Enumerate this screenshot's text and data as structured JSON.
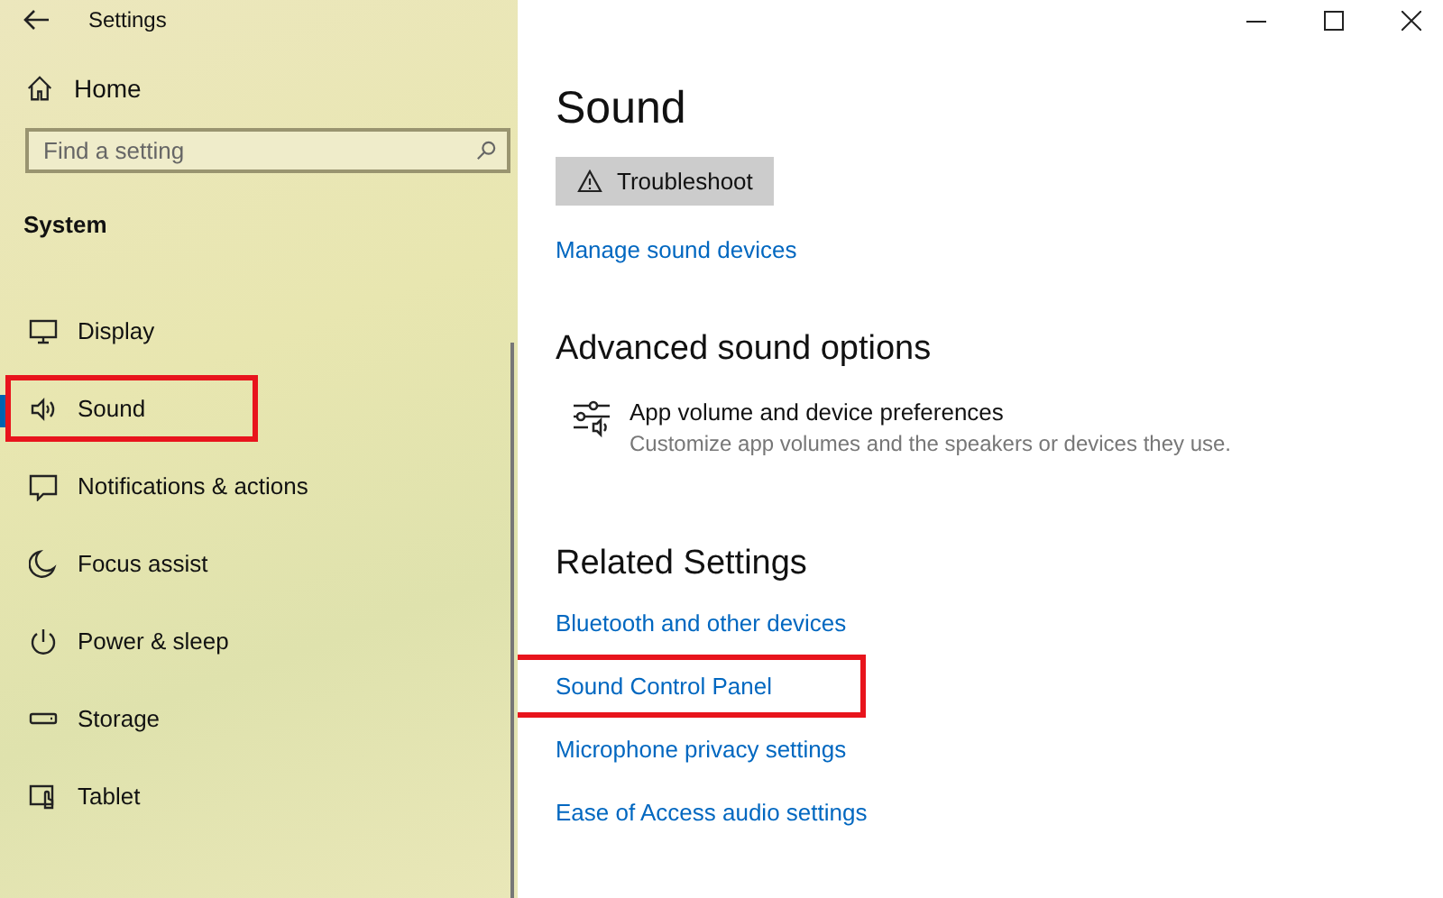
{
  "window": {
    "title": "Settings"
  },
  "sidebar": {
    "home": "Home",
    "search": {
      "placeholder": "Find a setting"
    },
    "section": "System",
    "items": [
      {
        "label": "Display",
        "kind": "display",
        "selected": false,
        "highlighted": false
      },
      {
        "label": "Sound",
        "kind": "sound",
        "selected": true,
        "highlighted": true
      },
      {
        "label": "Notifications & actions",
        "kind": "notifications",
        "selected": false,
        "highlighted": false
      },
      {
        "label": "Focus assist",
        "kind": "moon",
        "selected": false,
        "highlighted": false
      },
      {
        "label": "Power & sleep",
        "kind": "power",
        "selected": false,
        "highlighted": false
      },
      {
        "label": "Storage",
        "kind": "storage",
        "selected": false,
        "highlighted": false
      },
      {
        "label": "Tablet",
        "kind": "tablet",
        "selected": false,
        "highlighted": false
      }
    ]
  },
  "main": {
    "title": "Sound",
    "troubleshoot": "Troubleshoot",
    "manage_link": "Manage sound devices",
    "advanced": {
      "heading": "Advanced sound options",
      "title": "App volume and device preferences",
      "description": "Customize app volumes and the speakers or devices they use."
    },
    "related": {
      "heading": "Related Settings",
      "links": [
        {
          "label": "Bluetooth and other devices",
          "highlighted": false
        },
        {
          "label": "Sound Control Panel",
          "highlighted": true
        },
        {
          "label": "Microphone privacy settings",
          "highlighted": false
        },
        {
          "label": "Ease of Access audio settings",
          "highlighted": false
        }
      ]
    }
  }
}
